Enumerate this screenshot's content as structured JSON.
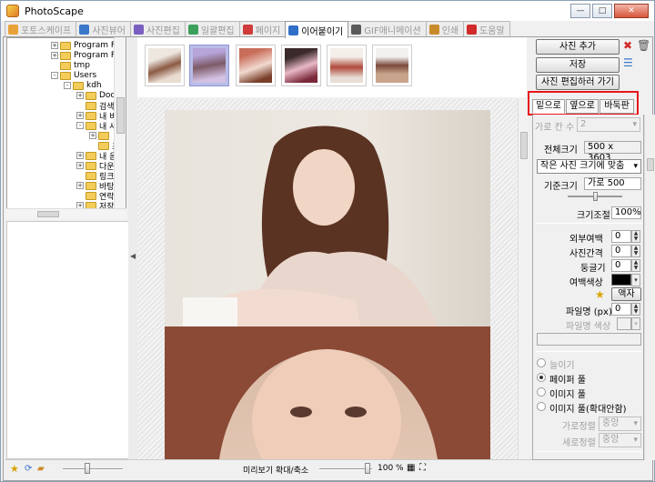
{
  "window": {
    "title": "PhotoScape"
  },
  "tabs": [
    {
      "label": "포토스케이프",
      "icon": "photoscape-icon",
      "color": "#e8a23a"
    },
    {
      "label": "사진뷰어",
      "icon": "viewer-icon",
      "color": "#3a78c9"
    },
    {
      "label": "사진편집",
      "icon": "editor-icon",
      "color": "#7a5fc0"
    },
    {
      "label": "일괄편집",
      "icon": "batch-icon",
      "color": "#3aa05a"
    },
    {
      "label": "페이지",
      "icon": "page-icon",
      "color": "#d03a3a"
    },
    {
      "label": "이어붙이기",
      "icon": "combine-icon",
      "color": "#2f6fc8"
    },
    {
      "label": "GIF애니메이션",
      "icon": "gif-icon",
      "color": "#5a5a5a"
    },
    {
      "label": "인쇄",
      "icon": "print-icon",
      "color": "#c98a2a"
    },
    {
      "label": "도움말",
      "icon": "help-icon",
      "color": "#d02a2a"
    }
  ],
  "tree": [
    {
      "label": "Program File",
      "indent": 0,
      "expander": "+"
    },
    {
      "label": "Program File",
      "indent": 0,
      "expander": "+"
    },
    {
      "label": "tmp",
      "indent": 0,
      "expander": ""
    },
    {
      "label": "Users",
      "indent": 0,
      "expander": "-"
    },
    {
      "label": "kdh",
      "indent": 1,
      "expander": "-"
    },
    {
      "label": "Docu",
      "indent": 2,
      "expander": "+"
    },
    {
      "label": "검색",
      "indent": 2,
      "expander": ""
    },
    {
      "label": "내 비",
      "indent": 2,
      "expander": "+"
    },
    {
      "label": "내 사",
      "indent": 2,
      "expander": "-"
    },
    {
      "label": "",
      "indent": 3,
      "expander": "+"
    },
    {
      "label": "초",
      "indent": 3,
      "expander": ""
    },
    {
      "label": "내 음",
      "indent": 2,
      "expander": "+"
    },
    {
      "label": "다운",
      "indent": 2,
      "expander": "+"
    },
    {
      "label": "링크",
      "indent": 2,
      "expander": ""
    },
    {
      "label": "바탕",
      "indent": 2,
      "expander": "+"
    },
    {
      "label": "연락",
      "indent": 2,
      "expander": ""
    },
    {
      "label": "저장",
      "indent": 2,
      "expander": "+"
    }
  ],
  "buttons": {
    "add_photo": "사진 추가",
    "save": "저장",
    "go_edit": "사진 편집하러 가기"
  },
  "subtabs": [
    "밑으로",
    "옆으로",
    "바둑판"
  ],
  "settings": {
    "col_count_label": "가로 칸 수",
    "col_count_value": "2",
    "total_size_label": "전체크기",
    "total_size_value": "500 x 3603",
    "fit_mode": "작은 사진 크기에 맞춤",
    "base_size_label": "기준크기",
    "base_size_value": "가로 500",
    "scale_label": "크기조절",
    "scale_value": "100%",
    "outer_margin_label": "외부여백",
    "outer_margin_value": "0",
    "spacing_label": "사진간격",
    "spacing_value": "0",
    "rounding_label": "둥글기",
    "rounding_value": "0",
    "margin_color_label": "여백색상",
    "margin_color": "#000000",
    "frame_button": "액자",
    "frame_line_label": "파일명 (px)",
    "frame_line_value": "0",
    "frame_color_label": "파일명 색상",
    "stretch_label": "늘이기",
    "paper_fill_label": "페이퍼 풀",
    "image_fill_label": "이미지 풀",
    "image_fill_small_label": "이미지 풀(확대안함)",
    "h_align_label": "가로정렬",
    "h_align_value": "중앙",
    "v_align_label": "세로정렬",
    "v_align_value": "중앙"
  },
  "statusbar": {
    "preview_zoom_label": "미리보기 확대/축소",
    "zoom_value": "100 %"
  },
  "colors": {
    "highlight": "#e8161b",
    "selected_thumb": "#b9bde8"
  }
}
